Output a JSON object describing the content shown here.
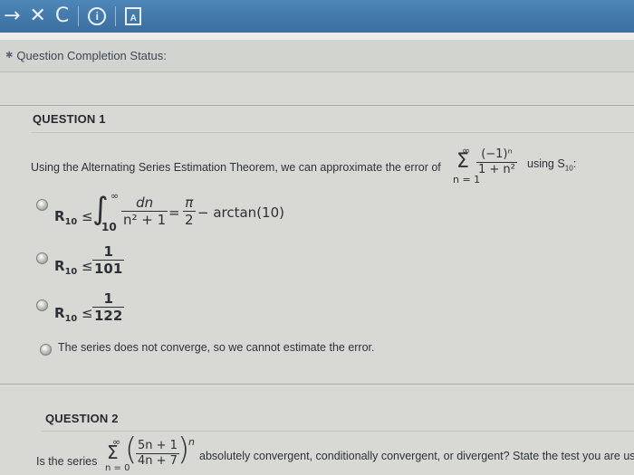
{
  "toolbar": {
    "icons": [
      "forward-arrow-icon",
      "close-icon",
      "reload-icon",
      "info-icon",
      "document-icon"
    ],
    "forward_glyph": "→",
    "close_glyph": "✕",
    "reload_glyph": "C",
    "info_glyph": "i",
    "doc_glyph": "A"
  },
  "status": {
    "label": "Question Completion Status:"
  },
  "question1": {
    "title": "QUESTION 1",
    "prompt": "Using the Alternating Series Estimation Theorem, we can approximate the error of",
    "series_numer": "(−1)ⁿ",
    "series_denom": "1 + n²",
    "series_lower": "n = 1",
    "series_upper": "∞",
    "using_text": "using S",
    "using_sub": "10",
    "using_colon": ":",
    "options": [
      {
        "lhs": "R",
        "lhs_sub": "10",
        "rel": "≤",
        "int_lower": "10",
        "int_upper": "∞",
        "int_num": "dn",
        "int_den": "n² + 1",
        "rhs_num": "π",
        "rhs_den": "2",
        "rhs_tail": " − arctan(10)"
      },
      {
        "lhs": "R",
        "lhs_sub": "10",
        "rel": "≤",
        "num": "1",
        "den": "101"
      },
      {
        "lhs": "R",
        "lhs_sub": "10",
        "rel": "≤",
        "num": "1",
        "den": "122"
      },
      {
        "text": "The series does not converge, so we cannot estimate the error."
      }
    ]
  },
  "question2": {
    "title": "QUESTION 2",
    "prompt_start": "Is the series",
    "series_upper": "∞",
    "series_lower": "n = 0",
    "series_numer": "5n + 1",
    "series_denom": "4n + 7",
    "series_power": "n",
    "prompt_end": "absolutely convergent, conditionally convergent, or divergent? State the test you are using a"
  }
}
